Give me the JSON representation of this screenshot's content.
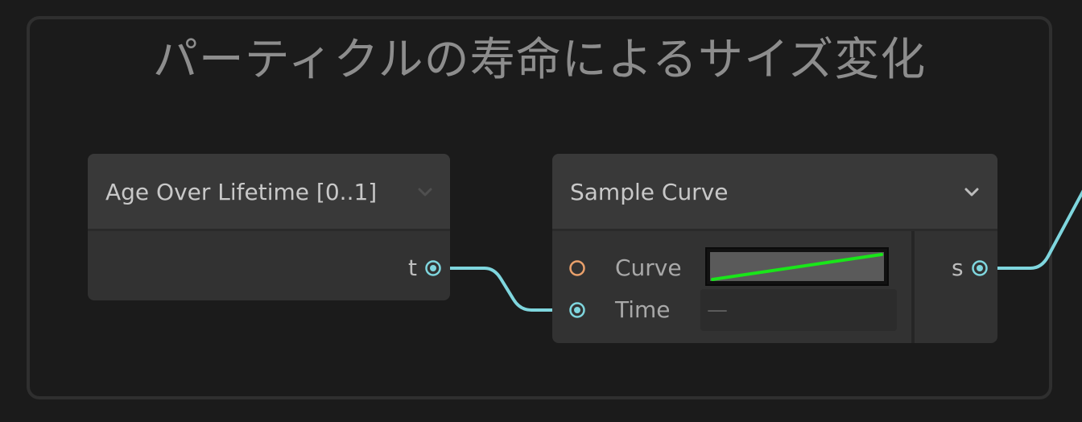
{
  "group": {
    "title": "パーティクルの寿命によるサイズ変化"
  },
  "nodes": {
    "age": {
      "title": "Age Over Lifetime [0..1]",
      "output": "t"
    },
    "curve": {
      "title": "Sample Curve",
      "inputs": {
        "curve": "Curve",
        "time": "Time",
        "time_value": "—"
      },
      "output": "s"
    }
  },
  "icons": {
    "collapse": "chevron-down-icon",
    "port": "port-dot-icon"
  },
  "colors": {
    "background": "#1b1b1b",
    "wire": "#7fd6de",
    "port_float": "#7fd6de",
    "port_curve": "#e9a06b",
    "curve_line": "#19e619"
  }
}
